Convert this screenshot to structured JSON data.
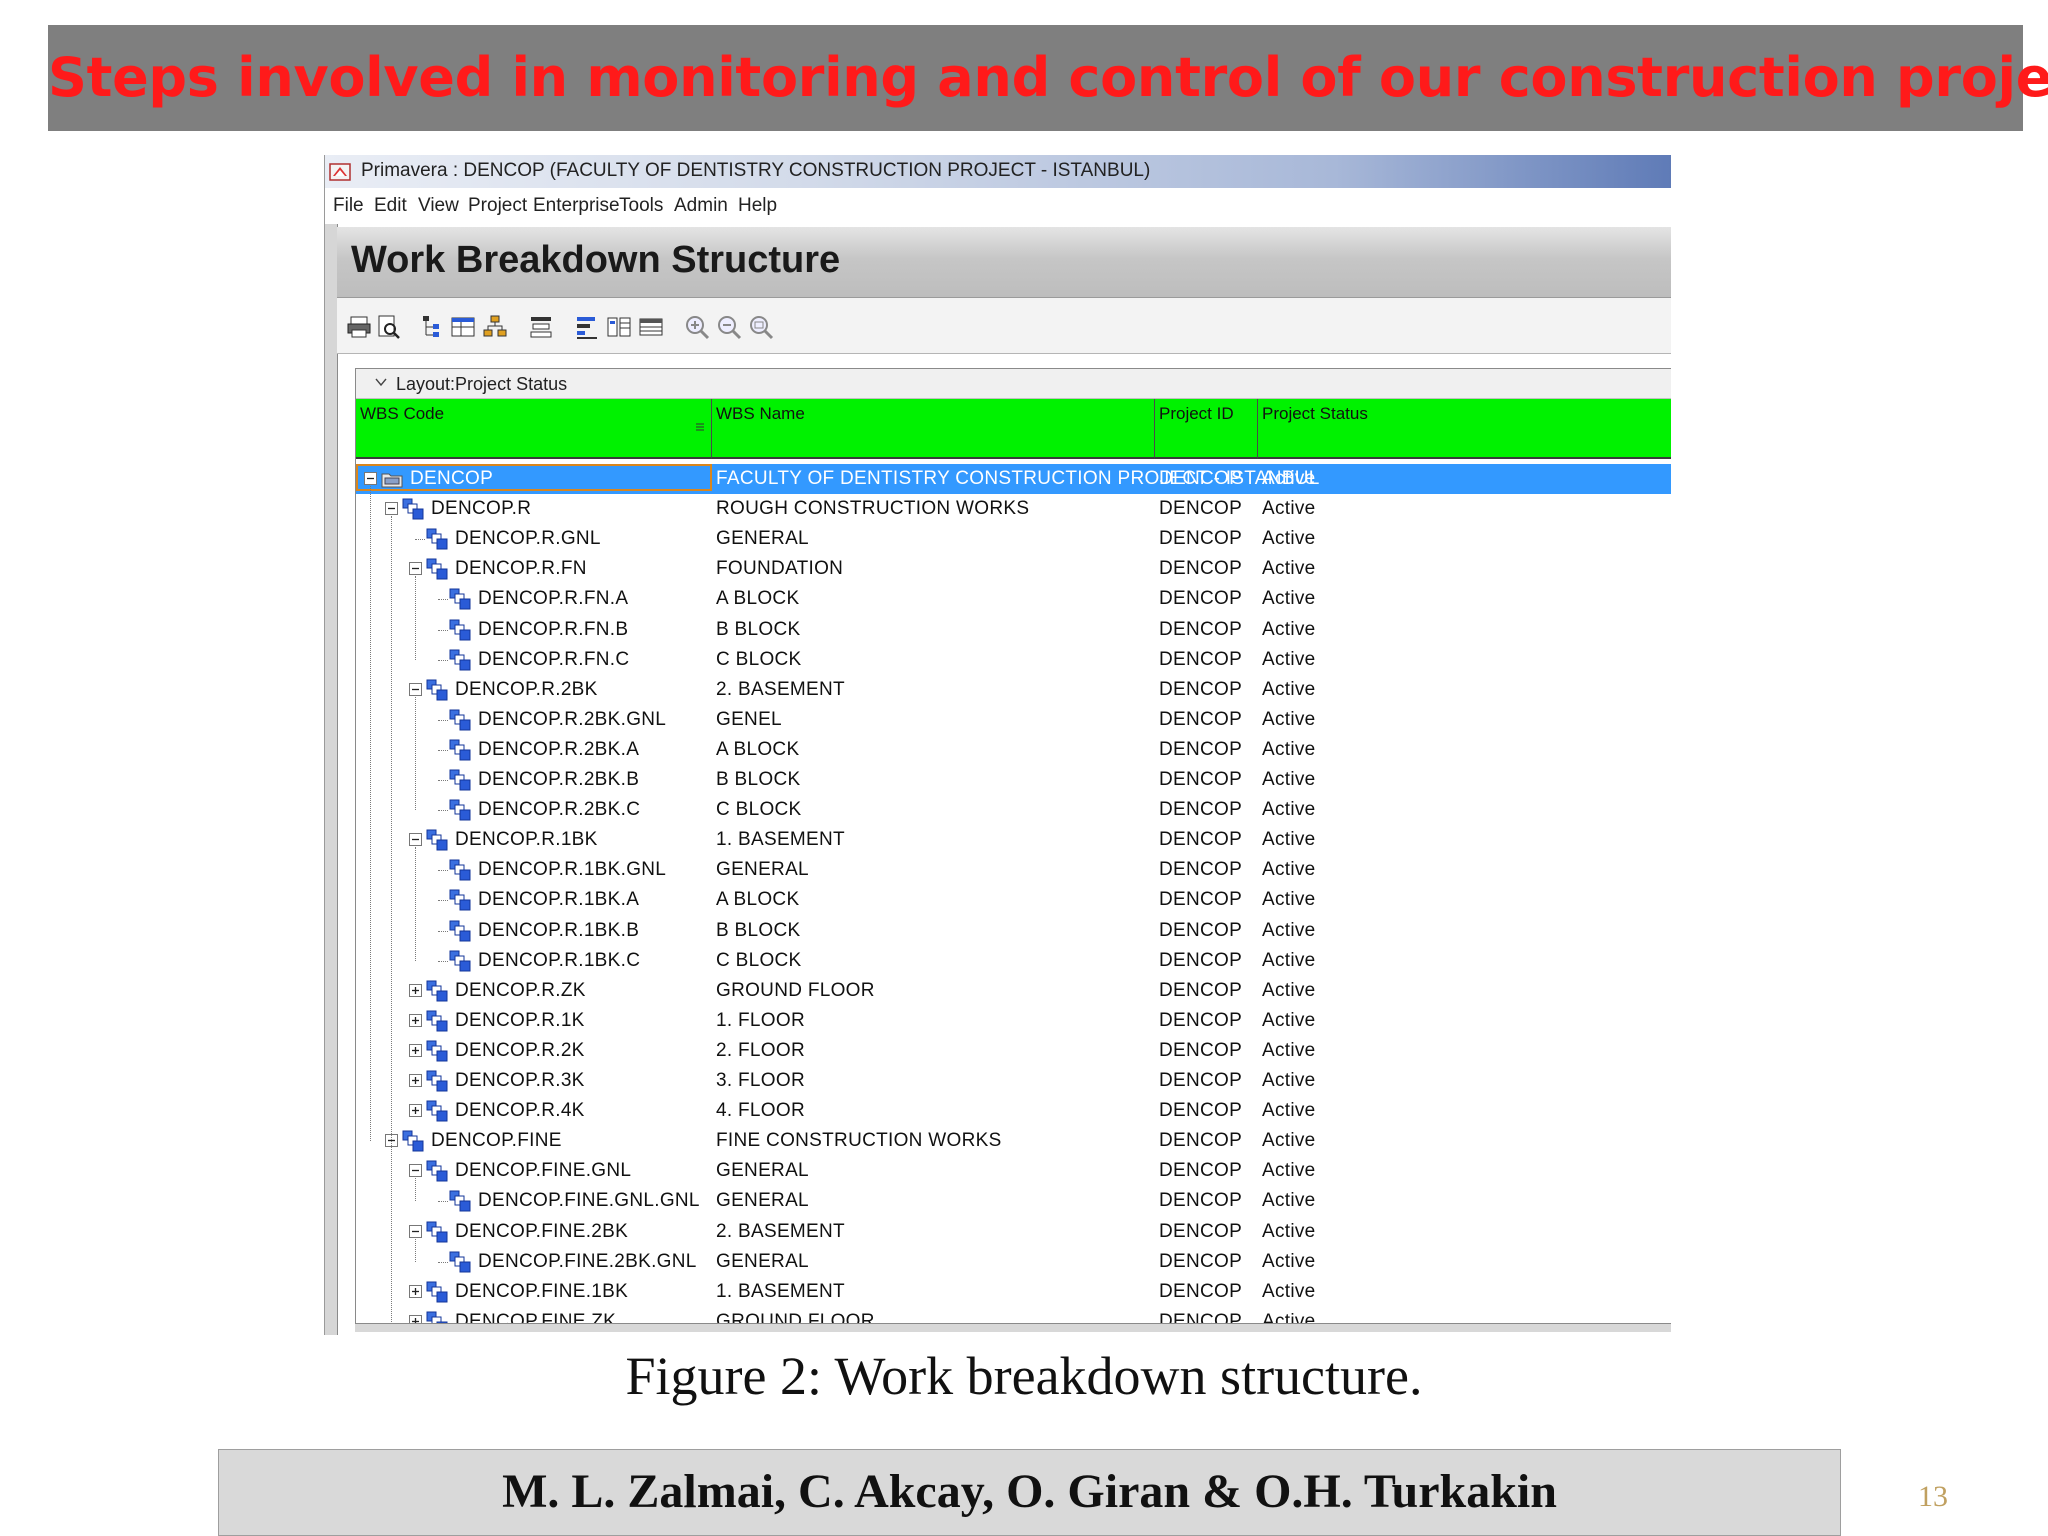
{
  "slide": {
    "title": "Steps involved in monitoring and control of our construction project",
    "caption": "Figure 2: Work breakdown structure.",
    "authors": "M. L. Zalmai, C. Akcay, O. Giran & O.H. Turkakin",
    "page_number": "13"
  },
  "app": {
    "window_title": "Primavera : DENCOP (FACULTY OF DENTISTRY CONSTRUCTION PROJECT - ISTANBUL)",
    "menu": [
      "File",
      "Edit",
      "View",
      "Project",
      "Enterprise",
      "Tools",
      "Admin",
      "Help"
    ],
    "view_title": "Work Breakdown Structure",
    "layout_label": "Layout:Project Status",
    "toolbar_icons": [
      "print-icon",
      "print-preview-icon",
      "hierarchy-icon",
      "columns-icon",
      "organize-icon",
      "filter-icon",
      "bar-chart-icon",
      "details-icon",
      "table-icon",
      "zoom-in-icon",
      "zoom-out-icon",
      "zoom-fit-icon"
    ],
    "colors": {
      "header_green": "#00f200",
      "selection_blue": "#3399ff",
      "title_red": "#ff1a1a"
    }
  },
  "table": {
    "columns": [
      "WBS Code",
      "WBS Name",
      "Project ID",
      "Project Status"
    ],
    "rows": [
      {
        "code": "DENCOP",
        "name": "FACULTY OF DENTISTRY CONSTRUCTION PROJECT - ISTANBUL",
        "project_id": "DENCOP",
        "status": "Active",
        "level": 0,
        "toggle": "minus",
        "icon": "project-icon",
        "selected": true
      },
      {
        "code": "DENCOP.R",
        "name": "ROUGH CONSTRUCTION WORKS",
        "project_id": "DENCOP",
        "status": "Active",
        "level": 1,
        "toggle": "minus",
        "icon": "wbs-icon"
      },
      {
        "code": "DENCOP.R.GNL",
        "name": "GENERAL",
        "project_id": "DENCOP",
        "status": "Active",
        "level": 2,
        "toggle": "none",
        "icon": "wbs-icon"
      },
      {
        "code": "DENCOP.R.FN",
        "name": "FOUNDATION",
        "project_id": "DENCOP",
        "status": "Active",
        "level": 2,
        "toggle": "minus",
        "icon": "wbs-icon"
      },
      {
        "code": "DENCOP.R.FN.A",
        "name": "A BLOCK",
        "project_id": "DENCOP",
        "status": "Active",
        "level": 3,
        "toggle": "none",
        "icon": "wbs-icon"
      },
      {
        "code": "DENCOP.R.FN.B",
        "name": "B BLOCK",
        "project_id": "DENCOP",
        "status": "Active",
        "level": 3,
        "toggle": "none",
        "icon": "wbs-icon"
      },
      {
        "code": "DENCOP.R.FN.C",
        "name": "C BLOCK",
        "project_id": "DENCOP",
        "status": "Active",
        "level": 3,
        "toggle": "none",
        "icon": "wbs-icon"
      },
      {
        "code": "DENCOP.R.2BK",
        "name": "2. BASEMENT",
        "project_id": "DENCOP",
        "status": "Active",
        "level": 2,
        "toggle": "minus",
        "icon": "wbs-icon"
      },
      {
        "code": "DENCOP.R.2BK.GNL",
        "name": "GENEL",
        "project_id": "DENCOP",
        "status": "Active",
        "level": 3,
        "toggle": "none",
        "icon": "wbs-icon"
      },
      {
        "code": "DENCOP.R.2BK.A",
        "name": "A BLOCK",
        "project_id": "DENCOP",
        "status": "Active",
        "level": 3,
        "toggle": "none",
        "icon": "wbs-icon"
      },
      {
        "code": "DENCOP.R.2BK.B",
        "name": "B BLOCK",
        "project_id": "DENCOP",
        "status": "Active",
        "level": 3,
        "toggle": "none",
        "icon": "wbs-icon"
      },
      {
        "code": "DENCOP.R.2BK.C",
        "name": "C BLOCK",
        "project_id": "DENCOP",
        "status": "Active",
        "level": 3,
        "toggle": "none",
        "icon": "wbs-icon"
      },
      {
        "code": "DENCOP.R.1BK",
        "name": "1. BASEMENT",
        "project_id": "DENCOP",
        "status": "Active",
        "level": 2,
        "toggle": "minus",
        "icon": "wbs-icon"
      },
      {
        "code": "DENCOP.R.1BK.GNL",
        "name": "GENERAL",
        "project_id": "DENCOP",
        "status": "Active",
        "level": 3,
        "toggle": "none",
        "icon": "wbs-icon"
      },
      {
        "code": "DENCOP.R.1BK.A",
        "name": "A BLOCK",
        "project_id": "DENCOP",
        "status": "Active",
        "level": 3,
        "toggle": "none",
        "icon": "wbs-icon"
      },
      {
        "code": "DENCOP.R.1BK.B",
        "name": "B BLOCK",
        "project_id": "DENCOP",
        "status": "Active",
        "level": 3,
        "toggle": "none",
        "icon": "wbs-icon"
      },
      {
        "code": "DENCOP.R.1BK.C",
        "name": "C BLOCK",
        "project_id": "DENCOP",
        "status": "Active",
        "level": 3,
        "toggle": "none",
        "icon": "wbs-icon"
      },
      {
        "code": "DENCOP.R.ZK",
        "name": "GROUND FLOOR",
        "project_id": "DENCOP",
        "status": "Active",
        "level": 2,
        "toggle": "plus",
        "icon": "wbs-icon"
      },
      {
        "code": "DENCOP.R.1K",
        "name": "1. FLOOR",
        "project_id": "DENCOP",
        "status": "Active",
        "level": 2,
        "toggle": "plus",
        "icon": "wbs-icon"
      },
      {
        "code": "DENCOP.R.2K",
        "name": "2. FLOOR",
        "project_id": "DENCOP",
        "status": "Active",
        "level": 2,
        "toggle": "plus",
        "icon": "wbs-icon"
      },
      {
        "code": "DENCOP.R.3K",
        "name": "3. FLOOR",
        "project_id": "DENCOP",
        "status": "Active",
        "level": 2,
        "toggle": "plus",
        "icon": "wbs-icon"
      },
      {
        "code": "DENCOP.R.4K",
        "name": "4. FLOOR",
        "project_id": "DENCOP",
        "status": "Active",
        "level": 2,
        "toggle": "plus",
        "icon": "wbs-icon"
      },
      {
        "code": "DENCOP.FINE",
        "name": "FINE CONSTRUCTION WORKS",
        "project_id": "DENCOP",
        "status": "Active",
        "level": 1,
        "toggle": "minus",
        "icon": "wbs-icon"
      },
      {
        "code": "DENCOP.FINE.GNL",
        "name": "GENERAL",
        "project_id": "DENCOP",
        "status": "Active",
        "level": 2,
        "toggle": "minus",
        "icon": "wbs-icon"
      },
      {
        "code": "DENCOP.FINE.GNL.GNL",
        "name": "GENERAL",
        "project_id": "DENCOP",
        "status": "Active",
        "level": 3,
        "toggle": "none",
        "icon": "wbs-icon"
      },
      {
        "code": "DENCOP.FINE.2BK",
        "name": "2. BASEMENT",
        "project_id": "DENCOP",
        "status": "Active",
        "level": 2,
        "toggle": "minus",
        "icon": "wbs-icon"
      },
      {
        "code": "DENCOP.FINE.2BK.GNL",
        "name": "GENERAL",
        "project_id": "DENCOP",
        "status": "Active",
        "level": 3,
        "toggle": "none",
        "icon": "wbs-icon"
      },
      {
        "code": "DENCOP.FINE.1BK",
        "name": "1. BASEMENT",
        "project_id": "DENCOP",
        "status": "Active",
        "level": 2,
        "toggle": "plus",
        "icon": "wbs-icon"
      },
      {
        "code": "DENCOP.FINE.ZK",
        "name": "GROUND FLOOR",
        "project_id": "DENCOP",
        "status": "Active",
        "level": 2,
        "toggle": "plus",
        "icon": "wbs-icon"
      }
    ]
  }
}
